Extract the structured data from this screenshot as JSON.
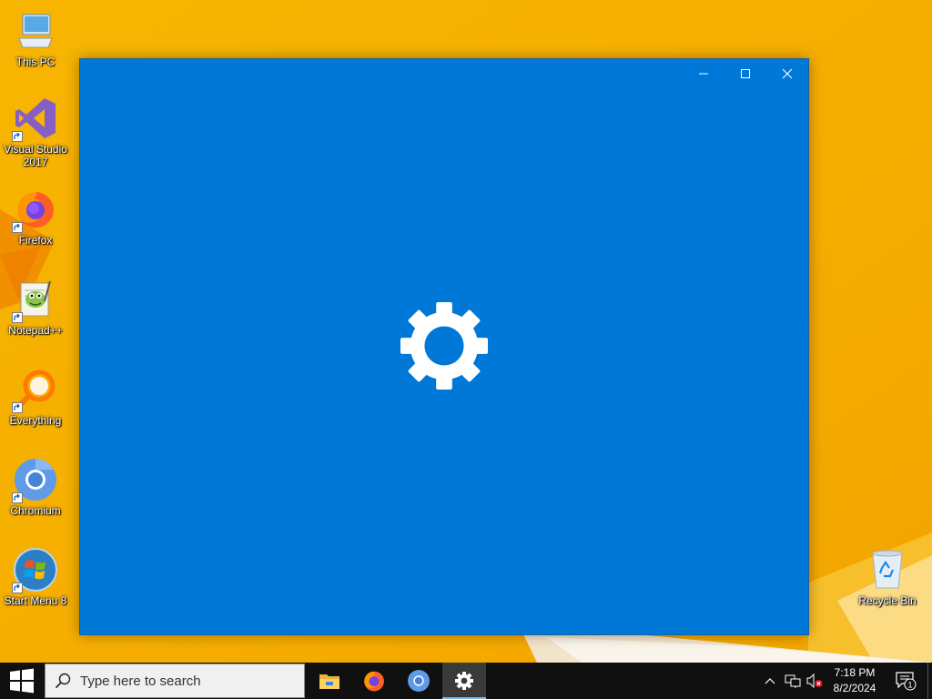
{
  "desktop": {
    "icons": [
      {
        "label": "This PC",
        "icon": "computer-icon"
      },
      {
        "label": "Visual Studio\n2017",
        "icon": "visual-studio-icon"
      },
      {
        "label": "Firefox",
        "icon": "firefox-icon"
      },
      {
        "label": "Notepad++",
        "icon": "notepad-plus-plus-icon"
      },
      {
        "label": "Everything",
        "icon": "everything-search-icon"
      },
      {
        "label": "Chromium",
        "icon": "chromium-icon"
      },
      {
        "label": "Start Menu 8",
        "icon": "start-menu-8-icon"
      },
      {
        "label": "Recycle Bin",
        "icon": "recycle-bin-icon"
      }
    ]
  },
  "window": {
    "app": "Settings",
    "background_color": "#0078d7",
    "splash_icon": "gear-icon",
    "controls": [
      "minimize-icon",
      "maximize-icon",
      "close-icon"
    ]
  },
  "taskbar": {
    "search_placeholder": "Type here to search",
    "pinned_apps": [
      "file-explorer-icon",
      "firefox-icon",
      "chromium-icon",
      "settings-gear-icon"
    ],
    "active_app": "Settings",
    "accent_color": "#76b9ed"
  },
  "system_tray": {
    "time": "7:18 PM",
    "date": "8/2/2024",
    "notification_count": "1",
    "icons": [
      "chevron-up-icon",
      "network-icon",
      "volume-muted-icon"
    ]
  }
}
